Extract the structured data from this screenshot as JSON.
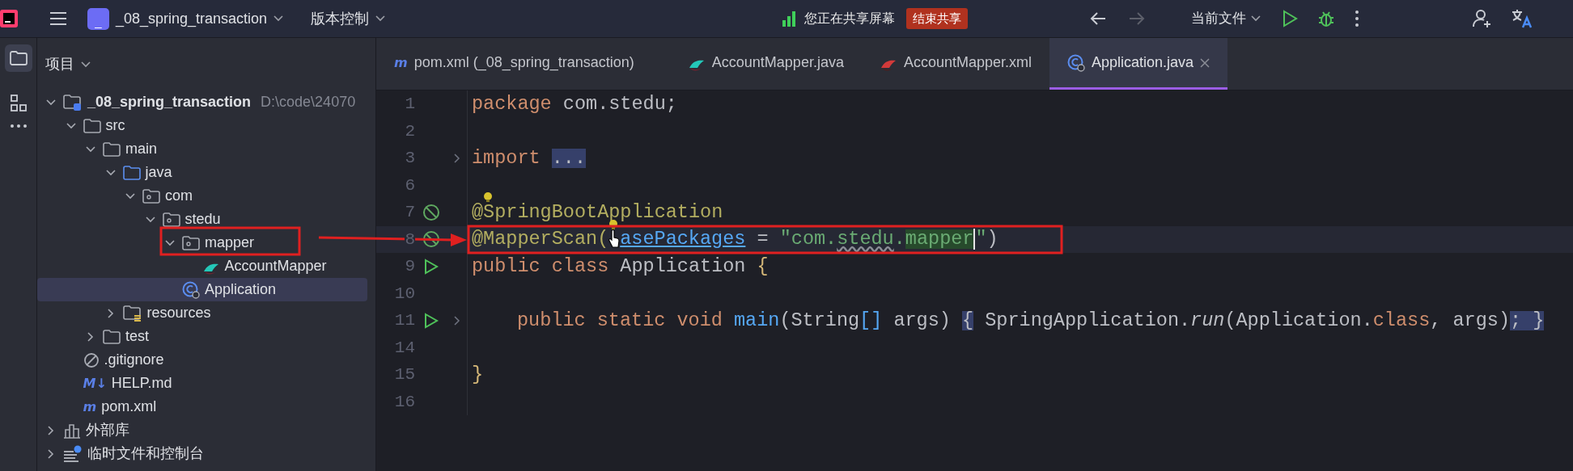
{
  "toolbar": {
    "project_badge": "_",
    "project": "_08_spring_transaction",
    "vcs": "版本控制",
    "sharing_text": "您正在共享屏幕",
    "stop_sharing": "结束共享",
    "back_enabled": true,
    "forward_enabled": false,
    "run_config": "当前文件"
  },
  "sidebar": {
    "title": "项目",
    "tree": [
      {
        "label": "_08_spring_transaction",
        "path": "D:\\code\\24070",
        "kind": "module",
        "expanded": true,
        "selected": false,
        "children": [
          {
            "label": "src",
            "kind": "folder",
            "expanded": true,
            "selected": false,
            "children": [
              {
                "label": "main",
                "kind": "folder",
                "expanded": true,
                "selected": false,
                "children": [
                  {
                    "label": "java",
                    "kind": "source",
                    "expanded": true,
                    "selected": false,
                    "children": [
                      {
                        "label": "com",
                        "kind": "package",
                        "expanded": true,
                        "selected": false,
                        "children": [
                          {
                            "label": "stedu",
                            "kind": "package",
                            "expanded": true,
                            "selected": false,
                            "children": [
                              {
                                "label": "mapper",
                                "kind": "package",
                                "expanded": true,
                                "selected": false,
                                "children": [
                                  {
                                    "label": "AccountMapper",
                                    "kind": "mapper",
                                    "selected": false
                                  }
                                ]
                              },
                              {
                                "label": "Application",
                                "kind": "class",
                                "selected": true
                              }
                            ]
                          }
                        ]
                      }
                    ]
                  },
                  {
                    "label": "resources",
                    "kind": "resources",
                    "expanded": false,
                    "selected": false
                  }
                ]
              },
              {
                "label": "test",
                "kind": "folder",
                "expanded": false,
                "selected": false
              }
            ]
          },
          {
            "label": ".gitignore",
            "kind": "ignore",
            "selected": false
          },
          {
            "label": "HELP.md",
            "kind": "badge",
            "badge": "M↓",
            "selected": false
          },
          {
            "label": "pom.xml",
            "kind": "badge",
            "badge": "m",
            "selected": false
          }
        ]
      },
      {
        "label": "外部库",
        "kind": "library",
        "expanded": false,
        "selected": false
      },
      {
        "label": "临时文件和控制台",
        "kind": "scratch",
        "expanded": false,
        "selected": false
      }
    ]
  },
  "tabs": [
    {
      "label": "pom.xml (_08_spring_transaction)",
      "kind": "badge",
      "badge": "m",
      "selected": false
    },
    {
      "label": "AccountMapper.java",
      "kind": "mapper",
      "selected": false
    },
    {
      "label": "AccountMapper.xml",
      "kind": "xml",
      "selected": false
    },
    {
      "label": "Application.java",
      "kind": "class",
      "selected": true
    }
  ],
  "code": [
    {
      "number": "1",
      "kind": "plain",
      "tokens": [
        {
          "kind": "keyword",
          "text": "package "
        },
        {
          "kind": "plain",
          "text": "com.stedu;"
        }
      ]
    },
    {
      "number": "2",
      "kind": "plain"
    },
    {
      "number": "3",
      "kind": "plain",
      "foldable": true,
      "tokens": [
        {
          "kind": "keyword",
          "text": "import "
        },
        {
          "kind": "fold",
          "text": "..."
        }
      ]
    },
    {
      "number": "6",
      "kind": "plain"
    },
    {
      "number": "7",
      "kind": "bean",
      "tokens": [
        {
          "kind": "annotation",
          "text": "@"
        },
        {
          "kind": "bulb"
        },
        {
          "kind": "annotation",
          "text": "SpringBootApplication"
        }
      ]
    },
    {
      "number": "8",
      "kind": "bean",
      "current": true,
      "tokens": [
        {
          "kind": "annotation",
          "text": "@MapperScan("
        },
        {
          "kind": "bulb"
        },
        {
          "kind": "pointer"
        },
        {
          "kind": "param",
          "text": "asePackages"
        },
        {
          "kind": "plain",
          "text": " = "
        },
        {
          "kind": "string",
          "text": "\"com."
        },
        {
          "kind": "typo",
          "text": "stedu"
        },
        {
          "kind": "string",
          "text": "."
        },
        {
          "kind": "match",
          "text": "mapper"
        },
        {
          "kind": "caret"
        },
        {
          "kind": "string",
          "text": "\""
        },
        {
          "kind": "plain",
          "text": ")"
        }
      ]
    },
    {
      "number": "9",
      "kind": "run",
      "tokens": [
        {
          "kind": "keyword",
          "text": "public class "
        },
        {
          "kind": "plain",
          "text": "Application "
        },
        {
          "kind": "brace",
          "text": "{"
        }
      ]
    },
    {
      "number": "10",
      "kind": "plain"
    },
    {
      "number": "11",
      "kind": "run",
      "foldable": true,
      "indented": true,
      "tokens": [
        {
          "kind": "keyword",
          "text": "public static void "
        },
        {
          "kind": "method",
          "text": "main"
        },
        {
          "kind": "plain",
          "text": "(String"
        },
        {
          "kind": "bracket",
          "text": "[]"
        },
        {
          "kind": "plain",
          "text": " args) "
        },
        {
          "kind": "fold",
          "text": "{"
        },
        {
          "kind": "plain",
          "text": " SpringApplication."
        },
        {
          "kind": "static",
          "text": "run"
        },
        {
          "kind": "plain",
          "text": "(Application."
        },
        {
          "kind": "keyword",
          "text": "class"
        },
        {
          "kind": "plain",
          "text": ", args)"
        },
        {
          "kind": "fold",
          "text": "; }"
        }
      ]
    },
    {
      "number": "14",
      "kind": "plain"
    },
    {
      "number": "15",
      "kind": "plain",
      "tokens": [
        {
          "kind": "brace",
          "text": "}"
        }
      ]
    },
    {
      "number": "16",
      "kind": "plain"
    }
  ]
}
